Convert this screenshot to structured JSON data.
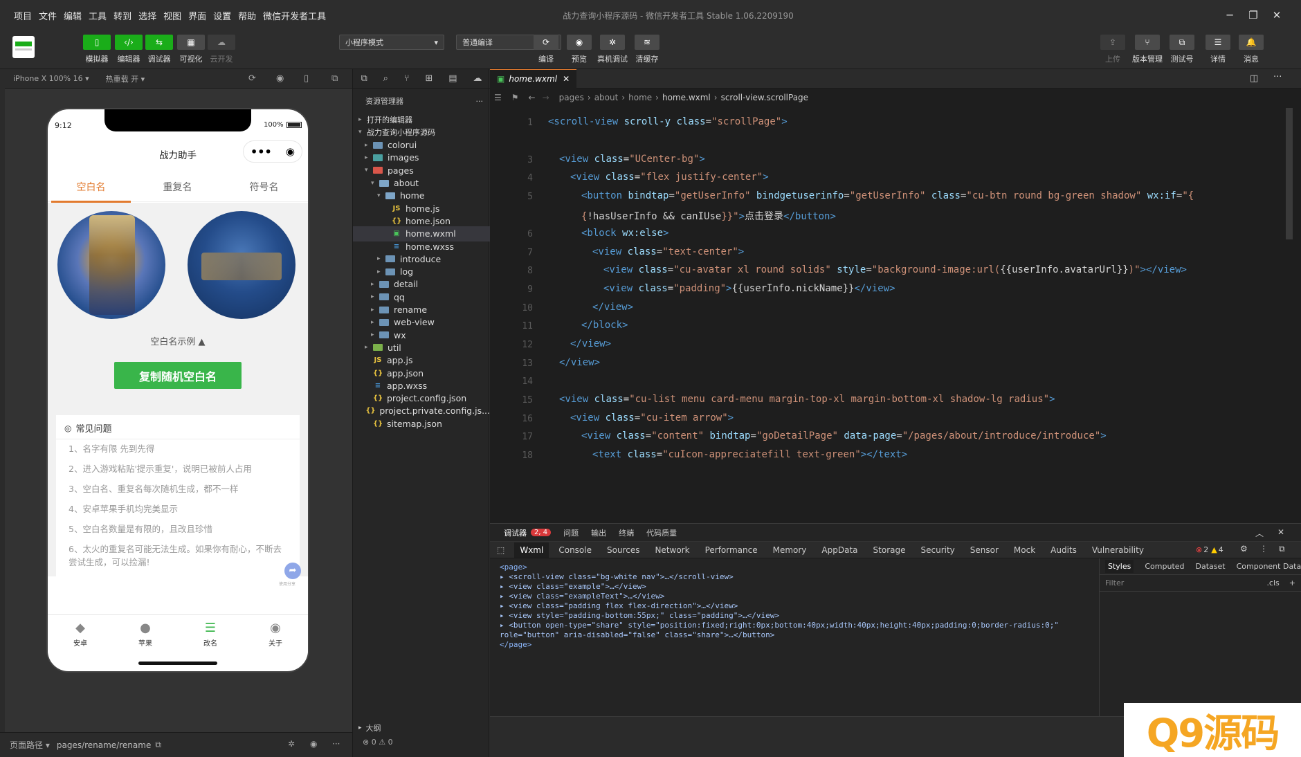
{
  "menu": [
    "项目",
    "文件",
    "编辑",
    "工具",
    "转到",
    "选择",
    "视图",
    "界面",
    "设置",
    "帮助",
    "微信开发者工具"
  ],
  "window_title": "战力查询小程序源码 - 微信开发者工具 Stable 1.06.2209190",
  "toolbar": {
    "left": [
      {
        "label": "模拟器",
        "icon": "phone-icon"
      },
      {
        "label": "编辑器",
        "icon": "code-icon"
      },
      {
        "label": "调试器",
        "icon": "debug-icon"
      },
      {
        "label": "可视化",
        "icon": "layout-icon"
      },
      {
        "label": "云开发",
        "icon": "cloud-icon"
      }
    ],
    "mode_select": "小程序模式",
    "compile_select": "普通编译",
    "mid": [
      {
        "label": "编译",
        "icon": "refresh-icon"
      },
      {
        "label": "预览",
        "icon": "eye-icon"
      },
      {
        "label": "真机调试",
        "icon": "bug-icon"
      },
      {
        "label": "清缓存",
        "icon": "layers-icon"
      }
    ],
    "right": [
      {
        "label": "上传",
        "icon": "upload-icon"
      },
      {
        "label": "版本管理",
        "icon": "branch-icon"
      },
      {
        "label": "测试号",
        "icon": "external-icon"
      },
      {
        "label": "详情",
        "icon": "menu-icon"
      },
      {
        "label": "消息",
        "icon": "bell-icon"
      }
    ]
  },
  "simulator": {
    "device": "iPhone X 100% 16 ▾",
    "hotreload": "热重载 开 ▾",
    "time": "9:12",
    "battery": "100%",
    "nav_title": "战力助手",
    "tabs": [
      "空白名",
      "重复名",
      "符号名"
    ],
    "example_label": "空白名示例 ▲",
    "copy_button": "复制随机空白名",
    "faq_title": "常见问题",
    "faq": [
      "1、名字有限 先到先得",
      "2、进入游戏粘贴'提示重复'，说明已被前人占用",
      "3、空白名、重复名每次随机生成，都不一样",
      "4、安卓苹果手机均完美显示",
      "5、空白名数量是有限的，且改且珍惜",
      "6、太火的重复名可能无法生成。如果你有耐心，不断去尝试生成，可以捡漏!"
    ],
    "tabbar": [
      "安卓",
      "苹果",
      "改名",
      "关于"
    ],
    "share_hint": "使用分享"
  },
  "explorer": {
    "title": "资源管理器",
    "items": [
      {
        "label": "打开的编辑器",
        "type": "section"
      },
      {
        "label": "战力查询小程序源码",
        "type": "section"
      },
      {
        "label": "colorui",
        "type": "folder"
      },
      {
        "label": "images",
        "type": "folder"
      },
      {
        "label": "pages",
        "type": "folder"
      },
      {
        "label": "about",
        "type": "folder"
      },
      {
        "label": "home",
        "type": "folder"
      },
      {
        "label": "home.js",
        "type": "js"
      },
      {
        "label": "home.json",
        "type": "json"
      },
      {
        "label": "home.wxml",
        "type": "wxml"
      },
      {
        "label": "home.wxss",
        "type": "wxss"
      },
      {
        "label": "introduce",
        "type": "folder"
      },
      {
        "label": "log",
        "type": "folder"
      },
      {
        "label": "detail",
        "type": "folder"
      },
      {
        "label": "qq",
        "type": "folder"
      },
      {
        "label": "rename",
        "type": "folder"
      },
      {
        "label": "web-view",
        "type": "folder"
      },
      {
        "label": "wx",
        "type": "folder"
      },
      {
        "label": "util",
        "type": "folder"
      },
      {
        "label": "app.js",
        "type": "js"
      },
      {
        "label": "app.json",
        "type": "json"
      },
      {
        "label": "app.wxss",
        "type": "wxss"
      },
      {
        "label": "project.config.json",
        "type": "json"
      },
      {
        "label": "project.private.config.js...",
        "type": "json"
      },
      {
        "label": "sitemap.json",
        "type": "json"
      }
    ],
    "outline": "大纲",
    "status": "⊗ 0 ⚠ 0"
  },
  "editor": {
    "tab": "home.wxml",
    "breadcrumb": [
      "pages",
      "about",
      "home",
      "home.wxml",
      "scroll-view.scrollPage"
    ],
    "line_numbers": [
      "1",
      "",
      "3",
      "4",
      "5",
      "",
      "6",
      "7",
      "8",
      "9",
      "10",
      "11",
      "12",
      "13",
      "14",
      "15",
      "16",
      "17",
      "18"
    ]
  },
  "devtools": {
    "top_tabs": [
      "调试器",
      "问题",
      "输出",
      "终端",
      "代码质量"
    ],
    "badge": "2, 4",
    "tabs": [
      "Wxml",
      "Console",
      "Sources",
      "Network",
      "Performance",
      "Memory",
      "AppData",
      "Storage",
      "Security",
      "Sensor",
      "Mock",
      "Audits",
      "Vulnerability"
    ],
    "errors": "2",
    "warnings": "4",
    "style_tabs": [
      "Styles",
      "Computed",
      "Dataset",
      "Component Data"
    ],
    "filter_placeholder": "Filter",
    "cls": ".cls",
    "dom": [
      "<page>",
      "▸ <scroll-view class=\"bg-white nav\">…</scroll-view>",
      "▸ <view class=\"example\">…</view>",
      "▸ <view class=\"exampleText\">…</view>",
      "▸ <view class=\"padding flex flex-direction\">…</view>",
      "▸ <view style=\"padding-bottom:55px;\" class=\"padding\">…</view>",
      "▸ <button open-type=\"share\" style=\"position:fixed;right:0px;bottom:40px;width:40px;height:40px;padding:0;border-radius:0;\"",
      "role=\"button\" aria-disabled=\"false\" class=\"share\">…</button>",
      "</page>"
    ]
  },
  "status": {
    "path_label": "页面路径 ▾",
    "path": "pages/rename/rename"
  },
  "watermark": "Q9源码"
}
